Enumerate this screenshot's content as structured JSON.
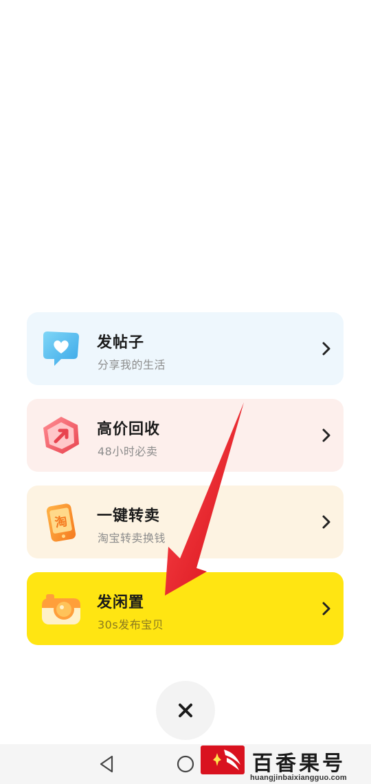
{
  "menu": {
    "items": [
      {
        "title": "发帖子",
        "subtitle": "分享我的生活",
        "bg": "#eef7fd",
        "icon": "heart-chat-icon"
      },
      {
        "title": "高价回收",
        "subtitle": "48小时必卖",
        "bg": "#fdefec",
        "icon": "recycle-arrow-icon"
      },
      {
        "title": "一键转卖",
        "subtitle": "淘宝转卖换钱",
        "bg": "#fdf3e2",
        "icon": "taobao-phone-icon",
        "icon_char": "淘"
      },
      {
        "title": "发闲置",
        "subtitle": "30s发布宝贝",
        "bg": "#ffe512",
        "icon": "camera-icon"
      }
    ]
  },
  "close": {
    "icon": "close-icon"
  },
  "nav": {
    "back_icon": "back-triangle-icon",
    "home_icon": "home-circle-icon"
  },
  "watermark": {
    "title": "百香果号",
    "url": "huangjinbaixiangguo.com"
  },
  "colors": {
    "accent_yellow": "#ffe512",
    "arrow_red": "#e8141b"
  }
}
